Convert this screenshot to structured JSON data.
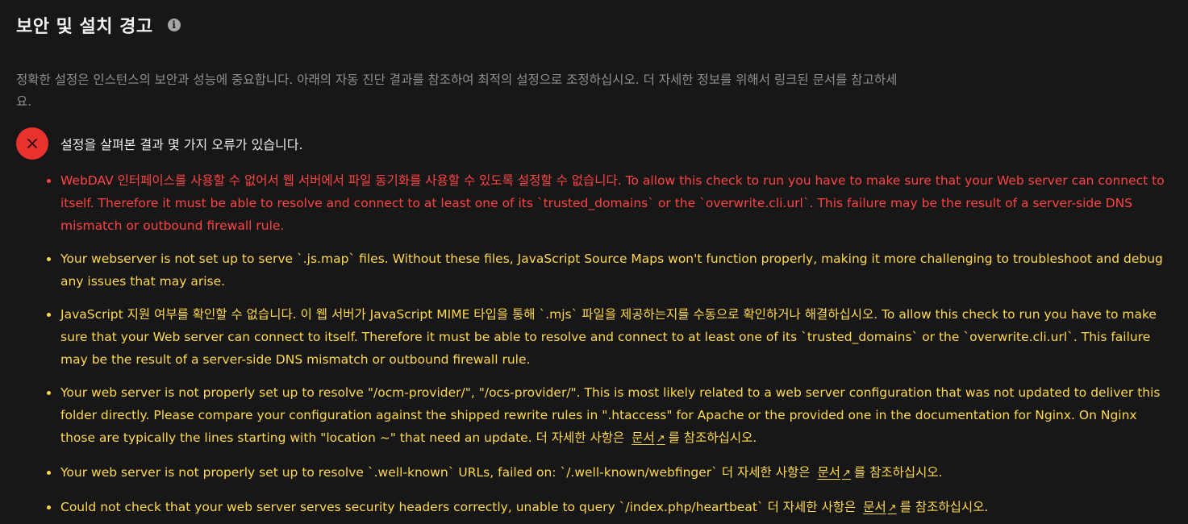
{
  "header": {
    "title": "보안 및 설치 경고",
    "info_icon": "info-icon"
  },
  "intro": {
    "text": "정확한 설정은 인스턴스의 보안과 성능에 중요합니다. 아래의 자동 진단 결과를 참조하여 최적의 설정으로 조정하십시오. 더 자세한 정보를 위해서 링크된 문서를 참고하세요."
  },
  "status": {
    "icon": "close-icon",
    "text": "설정을 살펴본 결과 몇 가지 오류가 있습니다."
  },
  "colors": {
    "error": "#ff4343",
    "warning": "#fed94d",
    "error_badge": "#e9322d",
    "background": "#171717"
  },
  "issues": [
    {
      "severity": "error",
      "text": "WebDAV 인터페이스를 사용할 수 없어서 웹 서버에서 파일 동기화를 사용할 수 있도록 설정할 수 없습니다. To allow this check to run you have to make sure that your Web server can connect to itself. Therefore it must be able to resolve and connect to at least one of its `trusted_domains` or the `overwrite.cli.url`. This failure may be the result of a server-side DNS mismatch or outbound firewall rule."
    },
    {
      "severity": "warning",
      "text": "Your webserver is not set up to serve `.js.map` files. Without these files, JavaScript Source Maps won't function properly, making it more challenging to troubleshoot and debug any issues that may arise."
    },
    {
      "severity": "warning",
      "text": "JavaScript 지원 여부를 확인할 수 없습니다. 이 웹 서버가 JavaScript MIME 타입을 통해 `.mjs` 파일을 제공하는지를 수동으로 확인하거나 해결하십시오. To allow this check to run you have to make sure that your Web server can connect to itself. Therefore it must be able to resolve and connect to at least one of its `trusted_domains` or the `overwrite.cli.url`. This failure may be the result of a server-side DNS mismatch or outbound firewall rule."
    },
    {
      "severity": "warning",
      "text": "Your web server is not properly set up to resolve \"/ocm-provider/\", \"/ocs-provider/\". This is most likely related to a web server configuration that was not updated to deliver this folder directly. Please compare your configuration against the shipped rewrite rules in \".htaccess\" for Apache or the provided one in the documentation for Nginx. On Nginx those are typically the lines starting with \"location ~\" that need an update. 더 자세한 사항은",
      "link": "문서",
      "link_icon": "↗",
      "after": "를 참조하십시오."
    },
    {
      "severity": "warning",
      "text": "Your web server is not properly set up to resolve `.well-known` URLs, failed on: `/.well-known/webfinger` 더 자세한 사항은",
      "link": "문서",
      "link_icon": "↗",
      "after": "를 참조하십시오."
    },
    {
      "severity": "warning",
      "text": "Could not check that your web server serves security headers correctly, unable to query `/index.php/heartbeat` 더 자세한 사항은",
      "link": "문서",
      "link_icon": "↗",
      "after": "를 참조하십시오."
    }
  ]
}
